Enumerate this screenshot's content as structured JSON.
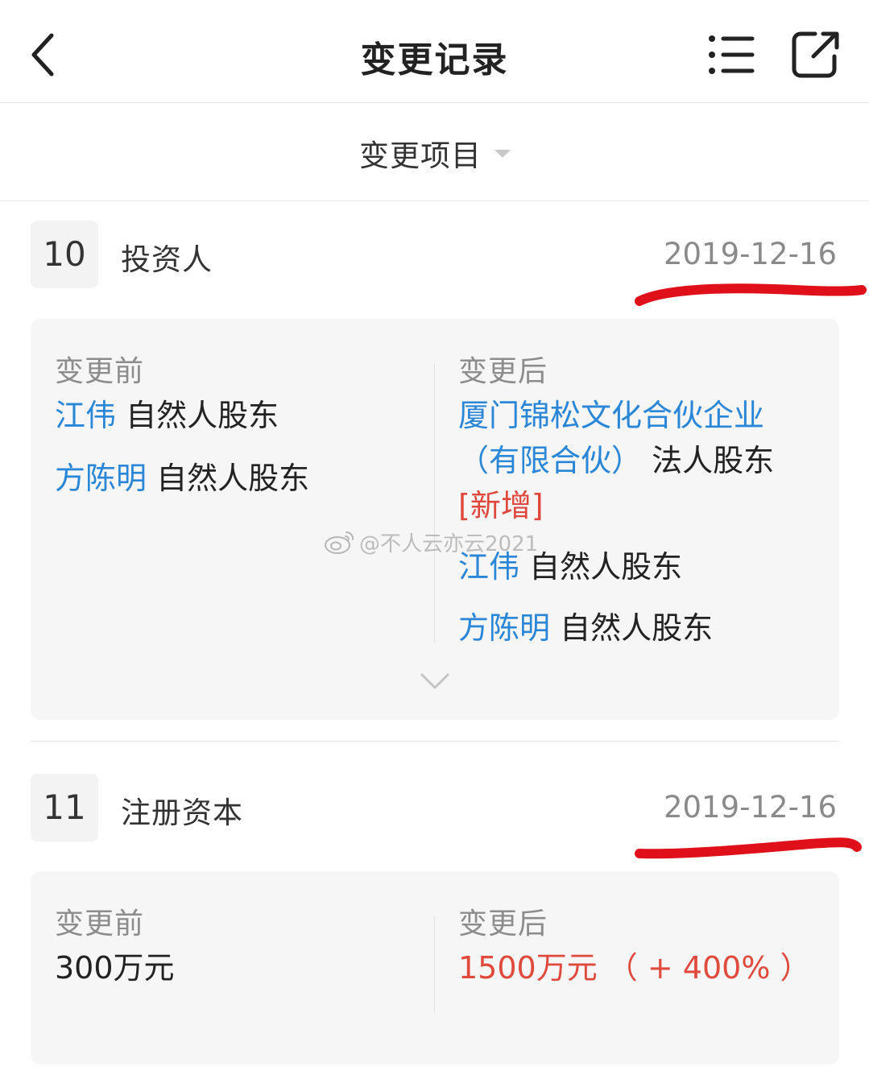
{
  "nav": {
    "title": "变更记录"
  },
  "filter": {
    "label": "变更项目"
  },
  "records": [
    {
      "num": "10",
      "title": "投资人",
      "date": "2019-12-16",
      "before_label": "变更前",
      "after_label": "变更后",
      "before": [
        {
          "name": "江伟",
          "role": "自然人股东"
        },
        {
          "name": "方陈明",
          "role": "自然人股东"
        }
      ],
      "after_first": {
        "name_line1": "厦门锦松文化合伙企业",
        "name_line2": "（有限合伙）",
        "role": "法人股东",
        "tag": "[新增]"
      },
      "after": [
        {
          "name": "江伟",
          "role": "自然人股东"
        },
        {
          "name": "方陈明",
          "role": "自然人股东"
        }
      ]
    },
    {
      "num": "11",
      "title": "注册资本",
      "date": "2019-12-16",
      "before_label": "变更前",
      "after_label": "变更后",
      "before_value": "300万元",
      "after_value": "1500万元 （ + 400% ）"
    }
  ],
  "watermark": "@不人云亦云2021",
  "colors": {
    "link": "#2a86d6",
    "highlight_red": "#e04a3d",
    "annotation": "#e0101a"
  },
  "icons": [
    "back-arrow-icon",
    "list-icon",
    "share-icon",
    "caret-down-icon",
    "chevron-down-icon",
    "weibo-icon"
  ]
}
